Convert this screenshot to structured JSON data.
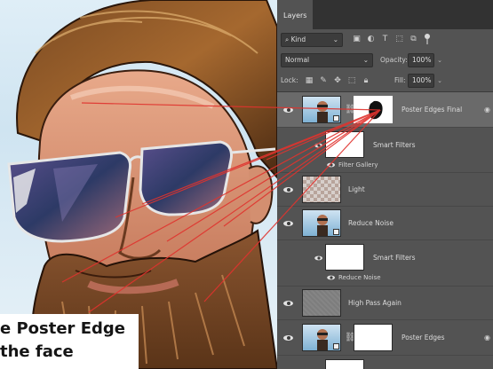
{
  "caption": {
    "line1": "e Poster Edge",
    "line2": "the face"
  },
  "panel": {
    "tab_label": "Layers",
    "filter": {
      "kind_label": "Kind",
      "icons": [
        "image-filter-icon",
        "adjustment-filter-icon",
        "type-filter-icon",
        "shape-filter-icon",
        "smart-object-filter-icon"
      ]
    },
    "blend_mode": "Normal",
    "opacity_label": "Opacity:",
    "opacity_value": "100%",
    "lock_label": "Lock:",
    "fill_label": "Fill:",
    "fill_value": "100%"
  },
  "layers": [
    {
      "name": "Poster Edges Final",
      "selected": true
    },
    {
      "name": "Smart Filters",
      "sub": "Filter Gallery"
    },
    {
      "name": "Light"
    },
    {
      "name": "Reduce Noise"
    },
    {
      "name": "Smart Filters",
      "sub": "Reduce Noise"
    },
    {
      "name": "High Pass Again"
    },
    {
      "name": "Poster Edges"
    }
  ],
  "colors": {
    "panel_bg": "#535353",
    "selected_row": "#6a6a6a",
    "annotation_lines": "#e0332e",
    "caption_bg": "#ffffff"
  }
}
